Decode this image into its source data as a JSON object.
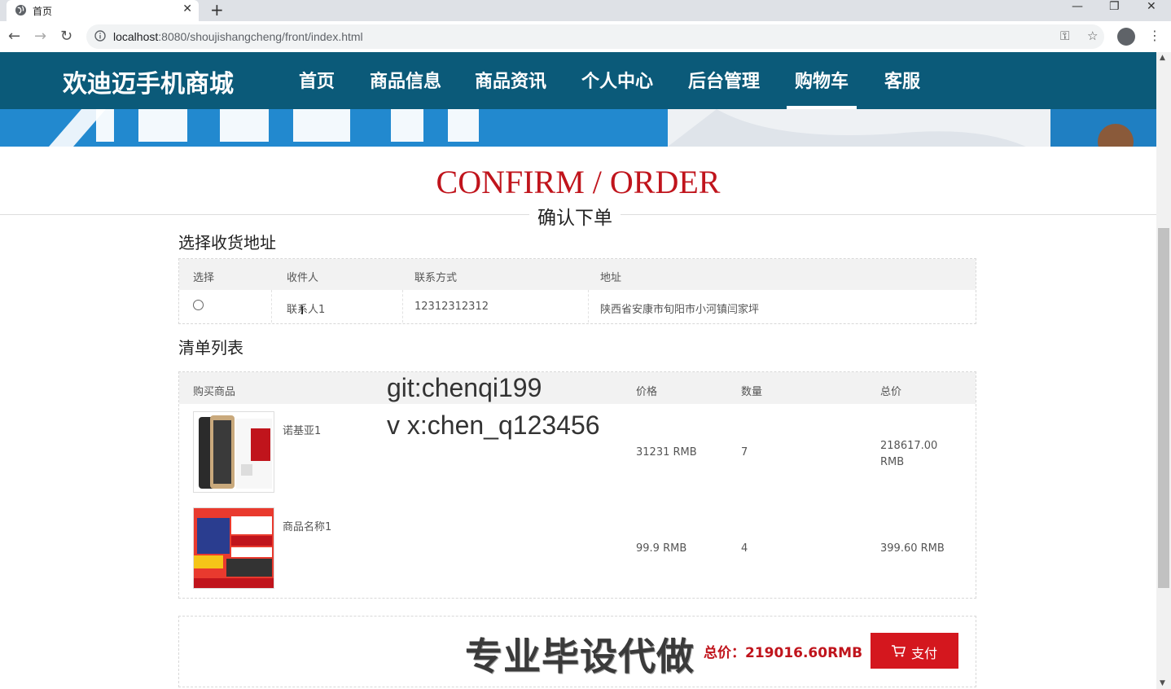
{
  "browser": {
    "tab_title": "首页",
    "url_host": "localhost",
    "url_path": ":8080/shoujishangcheng/front/index.html"
  },
  "site": {
    "logo": "欢迪迈手机商城",
    "nav": [
      "首页",
      "商品信息",
      "商品资讯",
      "个人中心",
      "后台管理",
      "购物车",
      "客服"
    ],
    "active_nav": "购物车"
  },
  "page": {
    "title_en": "CONFIRM / ORDER",
    "title_cn": "确认下单",
    "address_section": "选择收货地址",
    "address_table": {
      "headers": [
        "选择",
        "收件人",
        "联系方式",
        "地址"
      ],
      "rows": [
        {
          "name": "联系人1",
          "phone": "12312312312",
          "address": "陕西省安康市旬阳市小河镇闫家坪"
        }
      ]
    },
    "list_section": "清单列表",
    "items_table": {
      "headers": [
        "购买商品",
        "价格",
        "数量",
        "总价"
      ],
      "rows": [
        {
          "name": "诺基亚1",
          "price": "31231 RMB",
          "qty": "7",
          "total": "218617.00 RMB"
        },
        {
          "name": "商品名称1",
          "price": "99.9 RMB",
          "qty": "4",
          "total": "399.60 RMB"
        }
      ]
    },
    "total_label": "总价：219016.60RMB",
    "pay_label": "支付"
  },
  "overlays": {
    "line1": "git:chenqi199",
    "line2": "v x:chen_q123456",
    "big": "专业毕设代做"
  },
  "colors": {
    "header_bg": "#0b5a79",
    "accent_red": "#c0141c",
    "pay_button": "#d4171e"
  }
}
